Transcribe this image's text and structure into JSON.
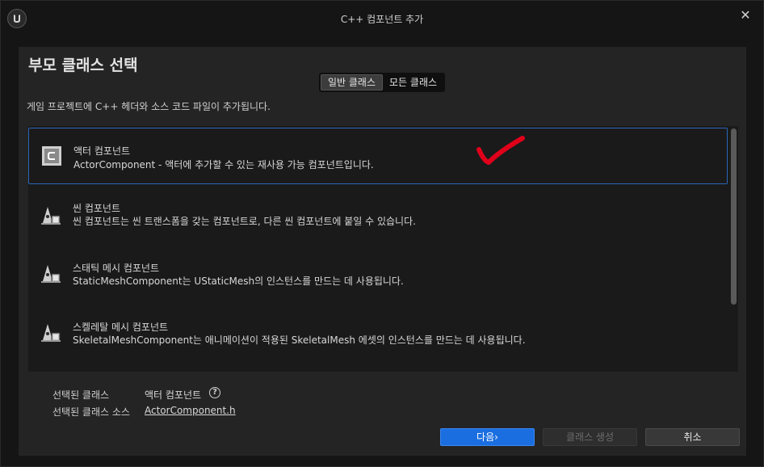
{
  "window": {
    "title": "C++ 컴포넌트 추가"
  },
  "heading": "부모 클래스 선택",
  "toggle": {
    "common": "일반 클래스",
    "all": "모든 클래스"
  },
  "description": "게임 프로젝트에 C++ 헤더와 소스 코드 파일이 추가됩니다.",
  "classes": [
    {
      "name": "액터 컴포넌트",
      "desc": "ActorComponent - 액터에 추가할 수 있는 재사용 가능 컴포넌트입니다.",
      "icon": "class-c-icon",
      "selected": true
    },
    {
      "name": "씬 컴포넌트",
      "desc": "씬 컴포넌트는 씬 트랜스폼을 갖는 컴포넌트로, 다른 씬 컴포넌트에 붙일 수 있습니다.",
      "icon": "scene-component-icon"
    },
    {
      "name": "스태틱 메시 컴포넌트",
      "desc": "StaticMeshComponent는 UStaticMesh의 인스턴스를 만드는 데 사용됩니다.",
      "icon": "static-mesh-component-icon"
    },
    {
      "name": "스켈레탈 메시 컴포넌트",
      "desc": "SkeletalMeshComponent는 애니메이션이 적용된 SkeletalMesh 에셋의 인스턴스를 만드는 데 사용됩니다.",
      "icon": "skeletal-mesh-component-icon"
    }
  ],
  "selected_info": {
    "class_label": "선택된 클래스",
    "class_value": "액터 컴포넌트",
    "source_label": "선택된 클래스 소스",
    "source_value": "ActorComponent.h"
  },
  "buttons": {
    "next": "다음",
    "create": "클래스 생성",
    "cancel": "취소"
  },
  "colors": {
    "accent": "#1a6ee0",
    "selection_border": "#2a66b8",
    "annotation": "#e0001a"
  }
}
